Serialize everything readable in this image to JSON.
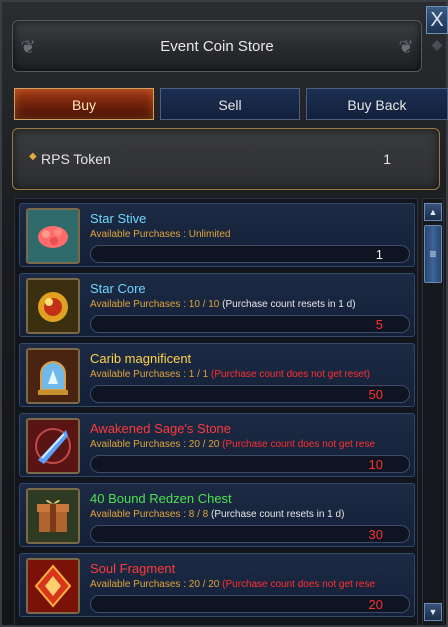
{
  "window": {
    "title": "Event Coin Store",
    "close_label": "X"
  },
  "tabs": [
    {
      "label": "Buy",
      "active": true
    },
    {
      "label": "Sell",
      "active": false
    },
    {
      "label": "Buy Back",
      "active": false
    }
  ],
  "currency": {
    "name": "RPS Token",
    "amount": "1"
  },
  "purchase_label": "Available Purchases : ",
  "items": [
    {
      "name": "Star Stive",
      "name_color": "#6fd6ff",
      "icon": "red-coral-icon",
      "available": "Unlimited",
      "note": "",
      "note_color": "#e0a43a",
      "price": "1",
      "price_color": "#f2f2f2"
    },
    {
      "name": "Star Core",
      "name_color": "#6fd6ff",
      "icon": "golden-orb-icon",
      "available": "10 / 10",
      "note": " (Purchase count resets in 1 d)",
      "note_color": "#e8e8e8",
      "price": "5",
      "price_color": "#ff3030"
    },
    {
      "name": "Carib magnificent",
      "name_color": "#ffd24a",
      "icon": "crystal-dome-icon",
      "available": "1 / 1",
      "note": " (Purchase count does not get reset)",
      "note_color": "#ff3030",
      "price": "50",
      "price_color": "#ff3030"
    },
    {
      "name": "Awakened Sage's Stone",
      "name_color": "#ff3a3a",
      "icon": "blue-crystal-icon",
      "available": "20 / 20",
      "note": " (Purchase count does not get rese",
      "note_color": "#ff3030",
      "price": "10",
      "price_color": "#ff3030"
    },
    {
      "name": "40 Bound Redzen Chest",
      "name_color": "#4ee04e",
      "icon": "gift-chest-icon",
      "available": "8 / 8",
      "note": " (Purchase count resets in 1 d)",
      "note_color": "#e8e8e8",
      "price": "30",
      "price_color": "#ff3030"
    },
    {
      "name": "Soul Fragment",
      "name_color": "#ff3a3a",
      "icon": "soul-fragment-icon",
      "available": "20 / 20",
      "note": " (Purchase count does not get rese",
      "note_color": "#ff3030",
      "price": "20",
      "price_color": "#ff3030"
    }
  ]
}
